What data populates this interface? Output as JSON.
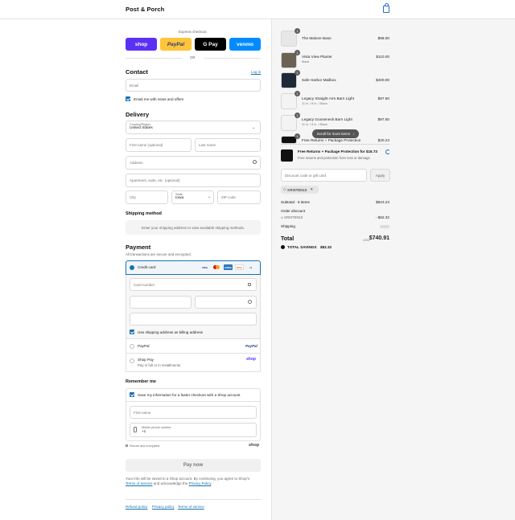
{
  "header": {
    "brand": "Post & Porch",
    "cart_icon": "shopping-bag-icon"
  },
  "express": {
    "title": "Express checkout",
    "buttons": [
      {
        "label": "shop",
        "color": "#5a31f4"
      },
      {
        "label": "PayPal",
        "color": "#ffc439"
      },
      {
        "label": "G Pay",
        "color": "#000000"
      },
      {
        "label": "venmo",
        "color": "#008cff"
      }
    ],
    "or": "OR"
  },
  "contact": {
    "title": "Contact",
    "login": "Log in",
    "email_placeholder": "Email",
    "news_label": "Email me with news and offers"
  },
  "delivery": {
    "title": "Delivery",
    "country_label": "Country/Region",
    "country_value": "United States",
    "first_name": "First name (optional)",
    "last_name": "Last name",
    "address": "Address",
    "apartment": "Apartment, suite, etc. (optional)",
    "city": "City",
    "state_label": "State",
    "state_value": "Iowa",
    "zip": "ZIP code"
  },
  "shipping": {
    "title": "Shipping method",
    "message": "Enter your shipping address to view available shipping methods."
  },
  "payment": {
    "title": "Payment",
    "subtitle": "All transactions are secure and encrypted.",
    "credit_card": "Credit card",
    "card_brands": [
      "VISA",
      "MC",
      "AMEX",
      "DISC",
      "+5"
    ],
    "card_number": "Card number",
    "billing_label": "Use shipping address as billing address",
    "paypal": "PayPal",
    "paypal_logo": "PayPal",
    "shop_pay": "Shop Pay",
    "shop_pay_sub": "Pay in full or in installments",
    "shop_logo": "shop"
  },
  "remember": {
    "title": "Remember me",
    "save_label": "Save my information for a faster checkout with a Shop account",
    "first_name": "First name",
    "phone_label": "Mobile phone number",
    "phone_value": "+1",
    "secure": "Secure and encrypted",
    "shop_logo": "shop"
  },
  "pay_button": "Pay now",
  "legal": {
    "text1": "Your info will be saved to a Shop account. By continuing, you agree to Shop's",
    "terms": "Terms of Service",
    "text2": "and acknowledge the",
    "privacy": "Privacy Policy",
    "end": "."
  },
  "footer_links": [
    "Refund policy",
    "Privacy policy",
    "Terms of service"
  ],
  "cart": {
    "items": [
      {
        "qty": "1",
        "name": "The Malone Base",
        "variant": "",
        "price": "$98.00"
      },
      {
        "qty": "1",
        "name": "Vista View Planter",
        "variant": "Black",
        "price": "$110.00"
      },
      {
        "qty": "1",
        "name": "Safe Harbor Mailbox",
        "variant": "",
        "price": "$400.00"
      },
      {
        "qty": "1",
        "name": "Legacy Straight Arm Barn Light",
        "variant": "11 in. / 8 in. / Black",
        "price": "$97.50"
      },
      {
        "qty": "1",
        "name": "Legacy Gooseneck Barn Light",
        "variant": "11 in. / 8 in. / Black",
        "price": "$97.50"
      },
      {
        "qty": "1",
        "name": "Free Returns + Package Protection",
        "variant": "",
        "price": "$20.23"
      }
    ],
    "scroll_tip": "Scroll for more items",
    "protection": {
      "title": "Free Returns + Package Protection for $16.73",
      "sub": "Free returns and protection from loss or damage"
    },
    "discount_placeholder": "Discount code or gift card",
    "apply": "Apply",
    "code": "KRISTEN10",
    "subtotal_label": "Subtotal · 6 items",
    "subtotal": "$823.23",
    "order_discount": "Order discount",
    "discount_code": "KRISTEN10",
    "discount_value": "- $82.32",
    "shipping_label": "Shipping",
    "total_label": "Total",
    "currency": "USD",
    "total": "$740.91",
    "savings_label": "TOTAL SAVINGS",
    "savings": "$82.32"
  }
}
